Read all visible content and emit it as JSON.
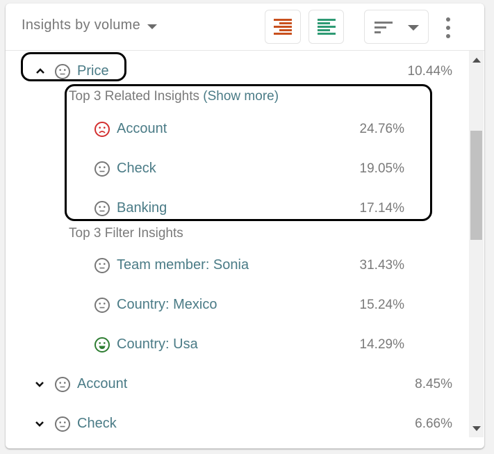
{
  "header": {
    "title": "Insights by volume",
    "buttons": [
      {
        "name": "align-right-button",
        "icon": "align-right-icon",
        "color": "#c8501e"
      },
      {
        "name": "align-left-button",
        "icon": "align-left-icon",
        "color": "#2e9a74"
      },
      {
        "name": "sort-dropdown-button",
        "icon": "sort-icon"
      },
      {
        "name": "more-options-button",
        "icon": "kebab-menu-icon"
      }
    ]
  },
  "colors": {
    "label": "#4a7b86",
    "muted": "#7a7a7a",
    "neutral_face": "#777777",
    "negative_face": "#d32f2f",
    "positive_face": "#2e7d32"
  },
  "insights": [
    {
      "label": "Price",
      "percent": "10.44%",
      "sentiment": "neutral",
      "expanded": true,
      "related_title": "Top 3 Related Insights",
      "related_link": "(Show more)",
      "related": [
        {
          "label": "Account",
          "percent": "24.76%",
          "sentiment": "negative"
        },
        {
          "label": "Check",
          "percent": "19.05%",
          "sentiment": "neutral"
        },
        {
          "label": "Banking",
          "percent": "17.14%",
          "sentiment": "neutral"
        }
      ],
      "filter_title": "Top 3 Filter Insights",
      "filters": [
        {
          "label": "Team member: Sonia",
          "percent": "31.43%",
          "sentiment": "neutral"
        },
        {
          "label": "Country: Mexico",
          "percent": "15.24%",
          "sentiment": "neutral"
        },
        {
          "label": "Country: Usa",
          "percent": "14.29%",
          "sentiment": "positive"
        }
      ]
    },
    {
      "label": "Account",
      "percent": "8.45%",
      "sentiment": "neutral",
      "expanded": false
    },
    {
      "label": "Check",
      "percent": "6.66%",
      "sentiment": "neutral",
      "expanded": false
    }
  ]
}
